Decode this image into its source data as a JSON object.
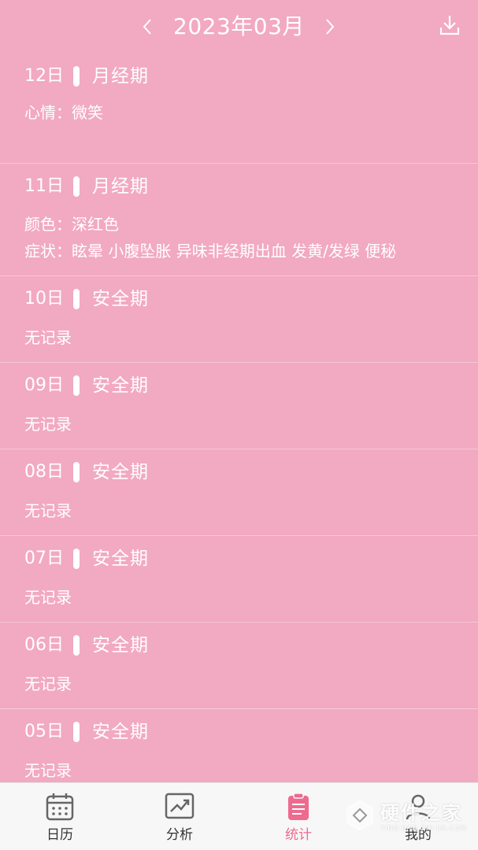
{
  "header": {
    "title": "2023年03月"
  },
  "entries": [
    {
      "day": "12日",
      "phase": "月经期",
      "lines": [
        "心情：微笑"
      ]
    },
    {
      "day": "11日",
      "phase": "月经期",
      "lines": [
        "颜色：深红色",
        "症状：眩晕 小腹坠胀 异味非经期出血 发黄/发绿 便秘"
      ]
    },
    {
      "day": "10日",
      "phase": "安全期",
      "lines": [
        "无记录"
      ]
    },
    {
      "day": "09日",
      "phase": "安全期",
      "lines": [
        "无记录"
      ]
    },
    {
      "day": "08日",
      "phase": "安全期",
      "lines": [
        "无记录"
      ]
    },
    {
      "day": "07日",
      "phase": "安全期",
      "lines": [
        "无记录"
      ]
    },
    {
      "day": "06日",
      "phase": "安全期",
      "lines": [
        "无记录"
      ]
    },
    {
      "day": "05日",
      "phase": "安全期",
      "lines": [
        "无记录"
      ]
    }
  ],
  "tabbar": {
    "tabs": [
      {
        "label": "日历",
        "icon": "calendar-icon"
      },
      {
        "label": "分析",
        "icon": "trend-chart-icon"
      },
      {
        "label": "统计",
        "icon": "clipboard-icon",
        "active": true
      },
      {
        "label": "我的",
        "icon": "user-icon"
      }
    ]
  },
  "watermark": {
    "main": "硬件之家",
    "sub": "YING JIAN ZHI JIA.COM"
  },
  "colors": {
    "background": "#f2a9c2",
    "accent": "#ee6a8f",
    "tabbar": "#f7f7f7",
    "text": "#ffffff"
  }
}
